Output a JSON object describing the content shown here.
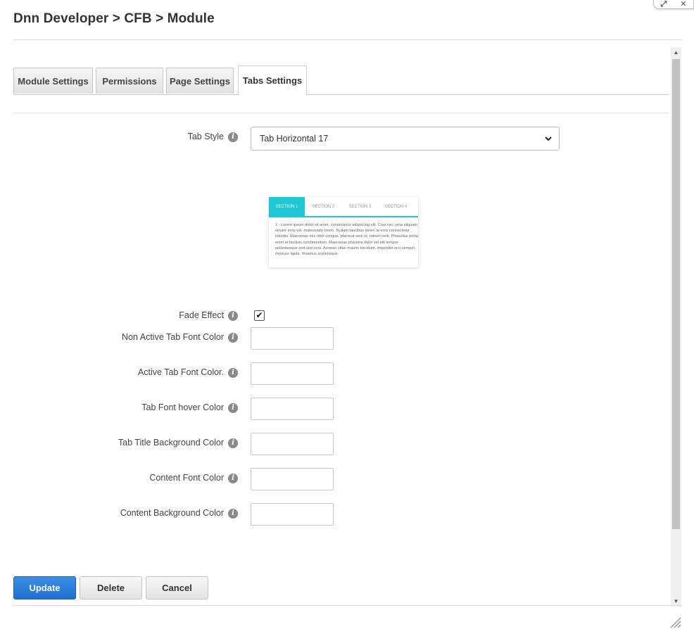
{
  "dialog": {
    "title": "Dnn Developer > CFB > Module",
    "controls": {
      "restore_icon": "restore-icon",
      "close_icon": "close-icon"
    }
  },
  "tabs": [
    {
      "label": "Module Settings",
      "active": false
    },
    {
      "label": "Permissions",
      "active": false
    },
    {
      "label": "Page Settings",
      "active": false
    },
    {
      "label": "Tabs Settings",
      "active": true
    }
  ],
  "form": {
    "tab_style": {
      "label": "Tab Style",
      "value": "Tab Horizontal 17"
    },
    "preview": {
      "tabs": [
        "SECTION 1",
        "SECTION 2",
        "SECTION 3",
        "SECTION 4"
      ],
      "text": "1 - Lorem ipsum dolor sit amet, consectetur adipiscing elit. Cras nec urna aliquam, ornare eros vel, malesuada lorem. Nullam faucibus lorem at eros consectetur lobortis. Maecenas nec nibh congue, placerat sem id, rutrum velit. Phasellus porta enim at facilisis condimentum. Maecenas pharetra dolor vel elit tempor pellentesque sed sed eros. Aenean vitae mauris tincidunt, imperdiet orci semper, rhoncus ligula. Vivamus scelerisque."
    },
    "fade_effect": {
      "label": "Fade Effect",
      "checked": true
    },
    "fields": [
      {
        "label": "Non Active Tab Font Color",
        "value": ""
      },
      {
        "label": "Active Tab Font Color.",
        "value": ""
      },
      {
        "label": "Tab Font hover Color",
        "value": ""
      },
      {
        "label": "Tab Title Background Color",
        "value": ""
      },
      {
        "label": "Content Font Color",
        "value": ""
      },
      {
        "label": "Content Background Color",
        "value": ""
      }
    ]
  },
  "buttons": {
    "update": "Update",
    "delete": "Delete",
    "cancel": "Cancel"
  },
  "colors": {
    "primary": "#1f6fcf",
    "preview_accent": "#1fc6d6"
  }
}
